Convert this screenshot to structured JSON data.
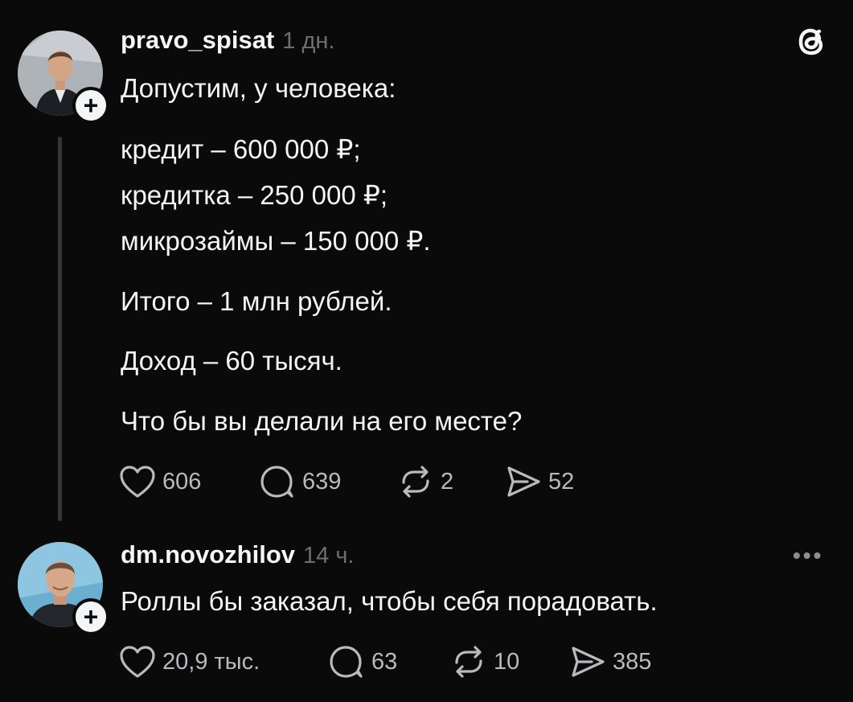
{
  "post": {
    "username": "pravo_spisat",
    "time": "1 дн.",
    "lines": [
      "Допустим, у человека:",
      "кредит – 600 000 ₽;",
      "кредитка – 250 000 ₽;",
      "микрозаймы – 150 000 ₽.",
      "Итого – 1 млн рублей.",
      "Доход – 60 тысяч.",
      "Что бы вы делали на его месте?"
    ],
    "likes": "606",
    "replies": "639",
    "reposts": "2",
    "shares": "52"
  },
  "reply": {
    "username": "dm.novozhilov",
    "time": "14 ч.",
    "text": "Роллы бы заказал, чтобы себя порадовать.",
    "likes": "20,9 тыс.",
    "replies": "63",
    "reposts": "10",
    "shares": "385",
    "more_label": "•••"
  },
  "follow_label": "+",
  "icons": {
    "app_logo": "threads-logo-icon",
    "like": "heart-icon",
    "reply": "comment-bubble-icon",
    "repost": "repost-icon",
    "share": "share-send-icon",
    "more": "more-dots-icon"
  }
}
